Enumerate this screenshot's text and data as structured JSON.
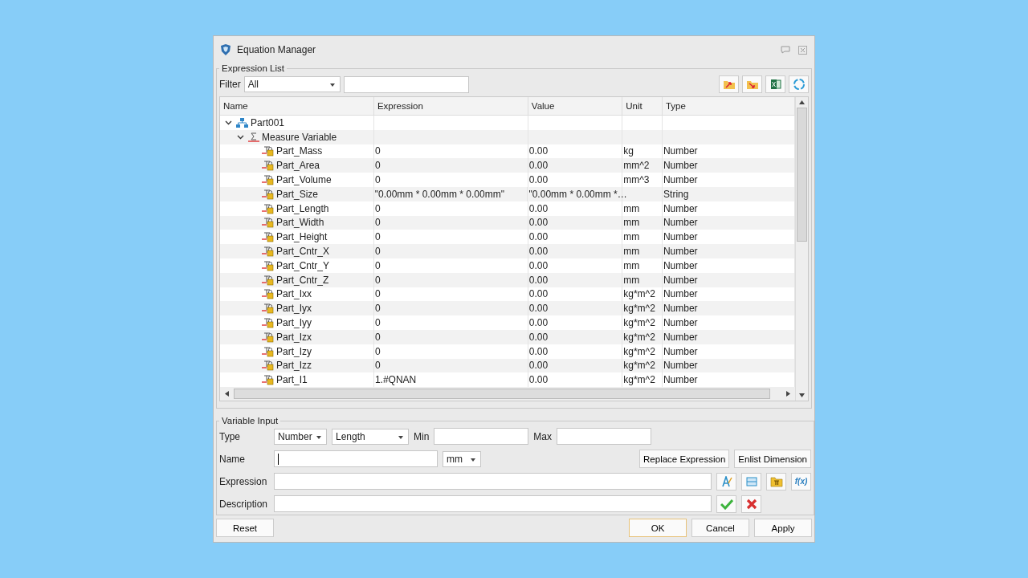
{
  "window": {
    "title": "Equation Manager"
  },
  "expression_list": {
    "title": "Expression List",
    "filter_label": "Filter",
    "filter_value": "All",
    "toolbar": [
      {
        "kind": "import"
      },
      {
        "kind": "export"
      },
      {
        "kind": "excel"
      },
      {
        "kind": "refresh"
      }
    ],
    "columns": [
      "Name",
      "Expression",
      "Value",
      "Unit",
      "Type"
    ],
    "tree": [
      {
        "name": "Part001",
        "kind": "part",
        "expanded": true,
        "children": [
          {
            "name": "Measure Variable",
            "kind": "group",
            "expanded": true,
            "children": [
              {
                "name": "Part_Mass",
                "kind": "variable",
                "expression": "0",
                "value": "0.00",
                "unit": "kg",
                "type": "Number"
              },
              {
                "name": "Part_Area",
                "kind": "variable",
                "expression": "0",
                "value": "0.00",
                "unit": "mm^2",
                "type": "Number"
              },
              {
                "name": "Part_Volume",
                "kind": "variable",
                "expression": "0",
                "value": "0.00",
                "unit": "mm^3",
                "type": "Number"
              },
              {
                "name": "Part_Size",
                "kind": "variable",
                "expression": "\"0.00mm * 0.00mm * 0.00mm\"",
                "value": "\"0.00mm * 0.00mm *…",
                "type": "String"
              },
              {
                "name": "Part_Length",
                "kind": "variable",
                "expression": "0",
                "value": "0.00",
                "unit": "mm",
                "type": "Number"
              },
              {
                "name": "Part_Width",
                "kind": "variable",
                "expression": "0",
                "value": "0.00",
                "unit": "mm",
                "type": "Number"
              },
              {
                "name": "Part_Height",
                "kind": "variable",
                "expression": "0",
                "value": "0.00",
                "unit": "mm",
                "type": "Number"
              },
              {
                "name": "Part_Cntr_X",
                "kind": "variable",
                "expression": "0",
                "value": "0.00",
                "unit": "mm",
                "type": "Number"
              },
              {
                "name": "Part_Cntr_Y",
                "kind": "variable",
                "expression": "0",
                "value": "0.00",
                "unit": "mm",
                "type": "Number"
              },
              {
                "name": "Part_Cntr_Z",
                "kind": "variable",
                "expression": "0",
                "value": "0.00",
                "unit": "mm",
                "type": "Number"
              },
              {
                "name": "Part_Ixx",
                "kind": "variable",
                "expression": "0",
                "value": "0.00",
                "unit": "kg*m^2",
                "type": "Number"
              },
              {
                "name": "Part_Iyx",
                "kind": "variable",
                "expression": "0",
                "value": "0.00",
                "unit": "kg*m^2",
                "type": "Number"
              },
              {
                "name": "Part_Iyy",
                "kind": "variable",
                "expression": "0",
                "value": "0.00",
                "unit": "kg*m^2",
                "type": "Number"
              },
              {
                "name": "Part_Izx",
                "kind": "variable",
                "expression": "0",
                "value": "0.00",
                "unit": "kg*m^2",
                "type": "Number"
              },
              {
                "name": "Part_Izy",
                "kind": "variable",
                "expression": "0",
                "value": "0.00",
                "unit": "kg*m^2",
                "type": "Number"
              },
              {
                "name": "Part_Izz",
                "kind": "variable",
                "expression": "0",
                "value": "0.00",
                "unit": "kg*m^2",
                "type": "Number"
              },
              {
                "name": "Part_I1",
                "kind": "variable",
                "expression": "1.#QNAN",
                "value": "0.00",
                "unit": "kg*m^2",
                "type": "Number"
              }
            ]
          }
        ]
      }
    ]
  },
  "variable_input": {
    "title": "Variable Input",
    "type_label": "Type",
    "type_value": "Number",
    "category_value": "Length",
    "min_label": "Min",
    "max_label": "Max",
    "name_label": "Name",
    "name_focused": true,
    "unit_value": "mm",
    "replace_button": "Replace Expression",
    "enlist_button": "Enlist Dimension",
    "expression_label": "Expression",
    "description_label": "Description",
    "expression_tools": [
      {
        "kind": "text-style"
      },
      {
        "kind": "measure"
      },
      {
        "kind": "constant"
      },
      {
        "kind": "function",
        "label": "f(x)"
      }
    ],
    "description_tools": [
      {
        "kind": "accept"
      },
      {
        "kind": "reject"
      }
    ]
  },
  "buttons": [
    {
      "label": "Reset",
      "default": false
    },
    {
      "label": "OK",
      "default": true
    },
    {
      "label": "Cancel",
      "default": false
    },
    {
      "label": "Apply",
      "default": false
    }
  ]
}
